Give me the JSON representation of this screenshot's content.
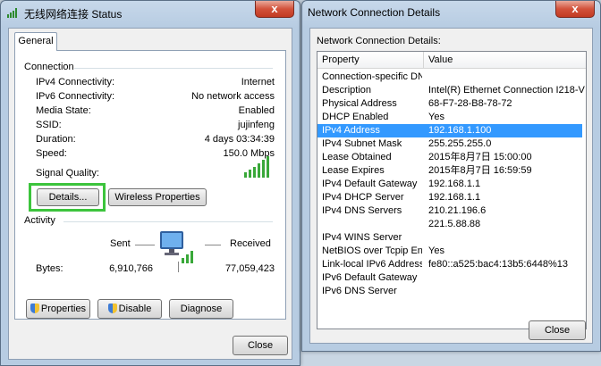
{
  "status_window": {
    "title": "无线网络连接 Status",
    "close_glyph": "x",
    "tab": "General",
    "connection_heading": "Connection",
    "rows": [
      {
        "label": "IPv4 Connectivity:",
        "value": "Internet"
      },
      {
        "label": "IPv6 Connectivity:",
        "value": "No network access"
      },
      {
        "label": "Media State:",
        "value": "Enabled"
      },
      {
        "label": "SSID:",
        "value": "jujinfeng"
      },
      {
        "label": "Duration:",
        "value": "4 days 03:34:39"
      },
      {
        "label": "Speed:",
        "value": "150.0 Mbps"
      }
    ],
    "signal_label": "Signal Quality:",
    "details_button": "Details...",
    "wireless_button": "Wireless Properties",
    "activity_heading": "Activity",
    "sent_label": "Sent",
    "received_label": "Received",
    "bytes_label": "Bytes:",
    "bytes_sent": "6,910,766",
    "bytes_received": "77,059,423",
    "properties_button": "Properties",
    "disable_button": "Disable",
    "diagnose_button": "Diagnose",
    "close_button": "Close",
    "highlight_color": "#3cc43c"
  },
  "details_window": {
    "title": "Network Connection Details",
    "close_glyph": "x",
    "heading": "Network Connection Details:",
    "columns": [
      "Property",
      "Value"
    ],
    "rows": [
      {
        "prop": "Connection-specific DN...",
        "val": ""
      },
      {
        "prop": "Description",
        "val": "Intel(R) Ethernet Connection I218-V"
      },
      {
        "prop": "Physical Address",
        "val": "68-F7-28-B8-78-72"
      },
      {
        "prop": "DHCP Enabled",
        "val": "Yes"
      },
      {
        "prop": "IPv4 Address",
        "val": "192.168.1.100"
      },
      {
        "prop": "IPv4 Subnet Mask",
        "val": "255.255.255.0"
      },
      {
        "prop": "Lease Obtained",
        "val": "2015年8月7日 15:00:00"
      },
      {
        "prop": "Lease Expires",
        "val": "2015年8月7日 16:59:59"
      },
      {
        "prop": "IPv4 Default Gateway",
        "val": "192.168.1.1"
      },
      {
        "prop": "IPv4 DHCP Server",
        "val": "192.168.1.1"
      },
      {
        "prop": "IPv4 DNS Servers",
        "val": "210.21.196.6"
      },
      {
        "prop": "",
        "val": "221.5.88.88"
      },
      {
        "prop": "IPv4 WINS Server",
        "val": ""
      },
      {
        "prop": "NetBIOS over Tcpip En...",
        "val": "Yes"
      },
      {
        "prop": "Link-local IPv6 Address",
        "val": "fe80::a525:bac4:13b5:6448%13"
      },
      {
        "prop": "IPv6 Default Gateway",
        "val": ""
      },
      {
        "prop": "IPv6 DNS Server",
        "val": ""
      }
    ],
    "selected_row": 4,
    "close_button": "Close"
  }
}
